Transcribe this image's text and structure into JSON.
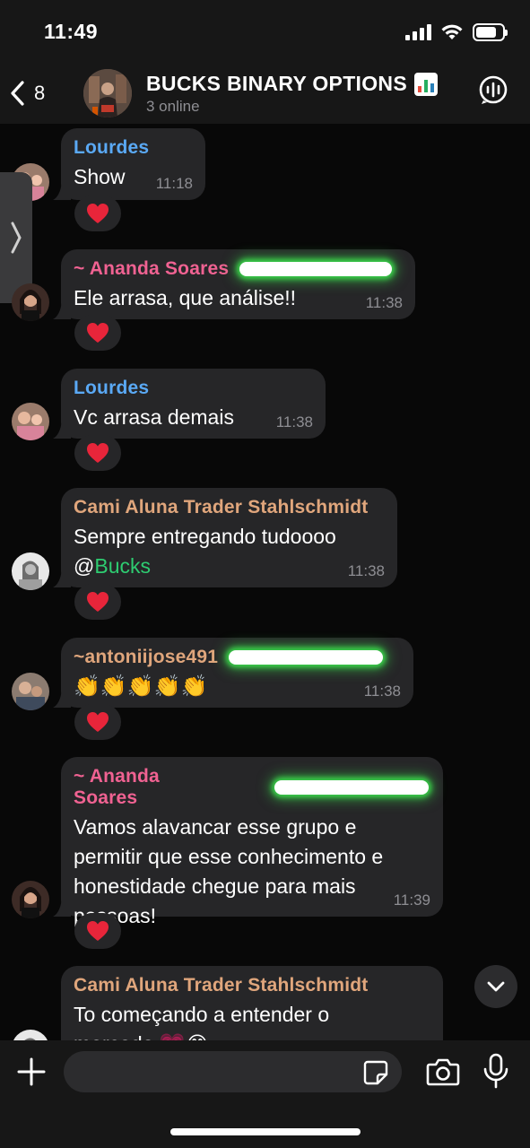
{
  "status_bar": {
    "time": "11:49",
    "signal_icon": "cellular-signal-icon",
    "wifi_icon": "wifi-icon",
    "battery_icon": "battery-icon"
  },
  "header": {
    "back_count": "8",
    "group_title": "BUCKS BINARY OPTIONS",
    "title_emoji": "bar-chart-emoji",
    "subtitle": "3 online",
    "call_icon": "voice-chat-icon"
  },
  "colors": {
    "lourdes": "#5aa9f5",
    "ananda": "#f06292",
    "cami": "#e0a67c",
    "antonii": "#e0a67c",
    "mention": "#2ecc71",
    "bubble": "#262628",
    "header_bg": "#171717"
  },
  "messages": [
    {
      "sender": "Lourdes",
      "text": "Show",
      "time": "11:18",
      "reaction": "❤️"
    },
    {
      "sender": "~ Ananda Soares",
      "text": "Ele arrasa, que análise!!",
      "time": "11:38",
      "reaction": "❤️"
    },
    {
      "sender": "Lourdes",
      "text": "Vc arrasa demais",
      "time": "11:38",
      "reaction": "❤️"
    },
    {
      "sender": "Cami Aluna Trader Stahlschmidt",
      "text_line1": "Sempre entregando tudoooo",
      "mention_prefix": "@",
      "mention": "Bucks",
      "time": "11:38",
      "reaction": "❤️"
    },
    {
      "sender": "~antoniijose491",
      "text": "👏👏👏👏👏",
      "time": "11:38",
      "reaction": "❤️"
    },
    {
      "sender": "~ Ananda Soares",
      "lines": [
        "Vamos alavancar esse grupo e",
        "permitir que esse conhecimento e",
        "honestidade chegue para mais",
        "pessoas!"
      ],
      "time": "11:39",
      "reaction": "❤️"
    },
    {
      "sender": "Cami Aluna Trader Stahlschmidt",
      "lines": [
        "To começando a entender o",
        "mercado 💗😂"
      ]
    }
  ],
  "composer": {
    "placeholder": ""
  }
}
